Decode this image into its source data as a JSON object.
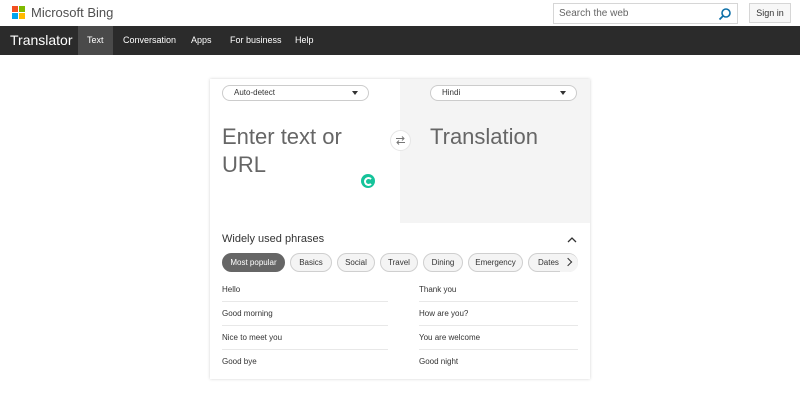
{
  "header": {
    "brand": "Microsoft Bing",
    "search_placeholder": "Search the web",
    "signin_label": "Sign in"
  },
  "nav": {
    "title": "Translator",
    "items": [
      "Text",
      "Conversation",
      "Apps",
      "For business",
      "Help"
    ],
    "active": "Text"
  },
  "translator": {
    "source_language": "Auto-detect",
    "target_language": "Hindi",
    "source_placeholder": "Enter text or URL",
    "target_placeholder": "Translation"
  },
  "phrases": {
    "title": "Widely used phrases",
    "categories": [
      "Most popular",
      "Basics",
      "Social",
      "Travel",
      "Dining",
      "Emergency",
      "Dates"
    ],
    "active_category": "Most popular",
    "left": [
      "Hello",
      "Good morning",
      "Nice to meet you",
      "Good bye"
    ],
    "right": [
      "Thank you",
      "How are you?",
      "You are welcome",
      "Good night"
    ]
  },
  "colors": {
    "nav_bg": "#2b2b2b",
    "active_chip": "#666666",
    "grammarly": "#15c39a"
  }
}
